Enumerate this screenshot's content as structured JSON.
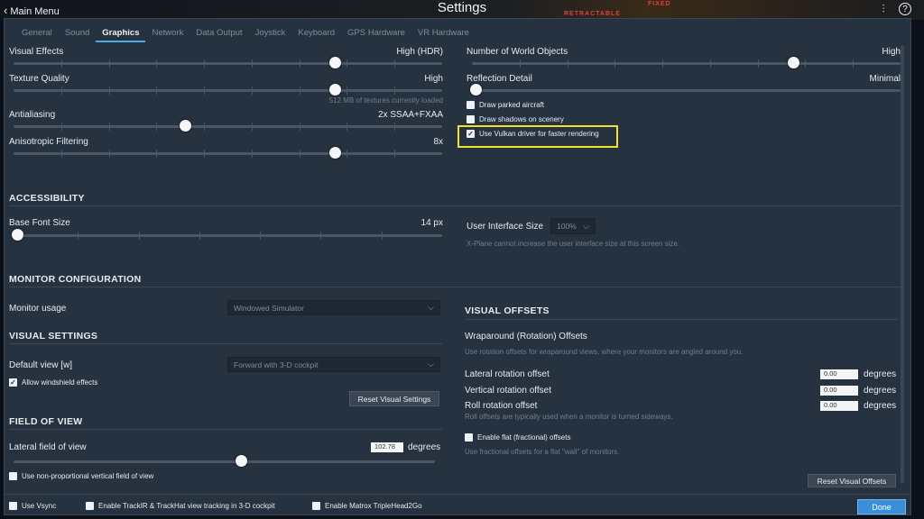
{
  "header": {
    "back_label": "Main Menu",
    "title": "Settings",
    "cockpit_word_1": "RETRACTABLE",
    "cockpit_word_2": "FIXED"
  },
  "tabs": [
    "General",
    "Sound",
    "Graphics",
    "Network",
    "Data Output",
    "Joystick",
    "Keyboard",
    "GPS Hardware",
    "VR Hardware"
  ],
  "active_tab": "Graphics",
  "graphics_left": {
    "visual_effects": {
      "label": "Visual Effects",
      "value": "High (HDR)",
      "level": 0.75
    },
    "texture_quality": {
      "label": "Texture Quality",
      "value": "High",
      "note": "512 MB of textures currently loaded",
      "level": 0.75
    },
    "antialiasing": {
      "label": "Antialiasing",
      "value": "2x SSAA+FXAA",
      "level": 0.4
    },
    "anisotropic": {
      "label": "Anisotropic Filtering",
      "value": "8x",
      "level": 0.75
    }
  },
  "graphics_right": {
    "world_objects": {
      "label": "Number of World Objects",
      "value": "High",
      "level": 0.75
    },
    "reflection": {
      "label": "Reflection Detail",
      "value": "Minimal",
      "level": 0.0
    },
    "draw_parked": "Draw parked aircraft",
    "draw_shadows": "Draw shadows on scenery",
    "vulkan": "Use Vulkan driver for faster rendering"
  },
  "accessibility": {
    "header": "ACCESSIBILITY",
    "font_size_label": "Base Font Size",
    "font_size_value": "14 px",
    "font_level": 0.0,
    "ui_size_label": "User Interface Size",
    "ui_size_value": "100%",
    "ui_size_note": "X-Plane cannot increase the user interface size at this screen size."
  },
  "monitor": {
    "header": "MONITOR CONFIGURATION",
    "usage_label": "Monitor usage",
    "usage_value": "Windowed Simulator"
  },
  "visual_settings": {
    "header": "VISUAL SETTINGS",
    "default_view_label": "Default view [w]",
    "default_view_value": "Forward with 3-D cockpit",
    "windshield": "Allow windshield effects",
    "reset_button": "Reset Visual Settings"
  },
  "fov": {
    "header": "FIELD OF VIEW",
    "lateral_label": "Lateral field of view",
    "lateral_value": "102.78",
    "unit": "degrees",
    "level": 0.54,
    "nonprop_partial": "Use non-proportional vertical field of view"
  },
  "visual_offsets": {
    "header": "VISUAL OFFSETS",
    "wrap_title": "Wraparound (Rotation) Offsets",
    "wrap_desc": "Use rotation offsets for wraparound views, where your monitors are angled around you.",
    "lateral_label": "Lateral rotation offset",
    "lateral_value": "0.00",
    "vertical_label": "Vertical rotation offset",
    "vertical_value": "0.00",
    "roll_label": "Roll rotation offset",
    "roll_value": "0.00",
    "roll_note": "Roll offsets are typically used when a monitor is turned sideways.",
    "unit": "degrees",
    "flat_label": "Enable flat (fractional) offsets",
    "flat_desc": "Use fractional offsets for a flat \"wall\" of monitors.",
    "reset_partial": "Reset Visual Offsets"
  },
  "footer": {
    "vsync": "Use Vsync",
    "trackir": "Enable TrackIR & TrackHat view tracking in 3-D cockpit",
    "matrox": "Enable Matrox TripleHead2Go",
    "done": "Done"
  },
  "colors": {
    "panel": "#26323f",
    "accent": "#4aa8e8",
    "highlight": "#f0e22a",
    "done": "#3a8fd8"
  }
}
